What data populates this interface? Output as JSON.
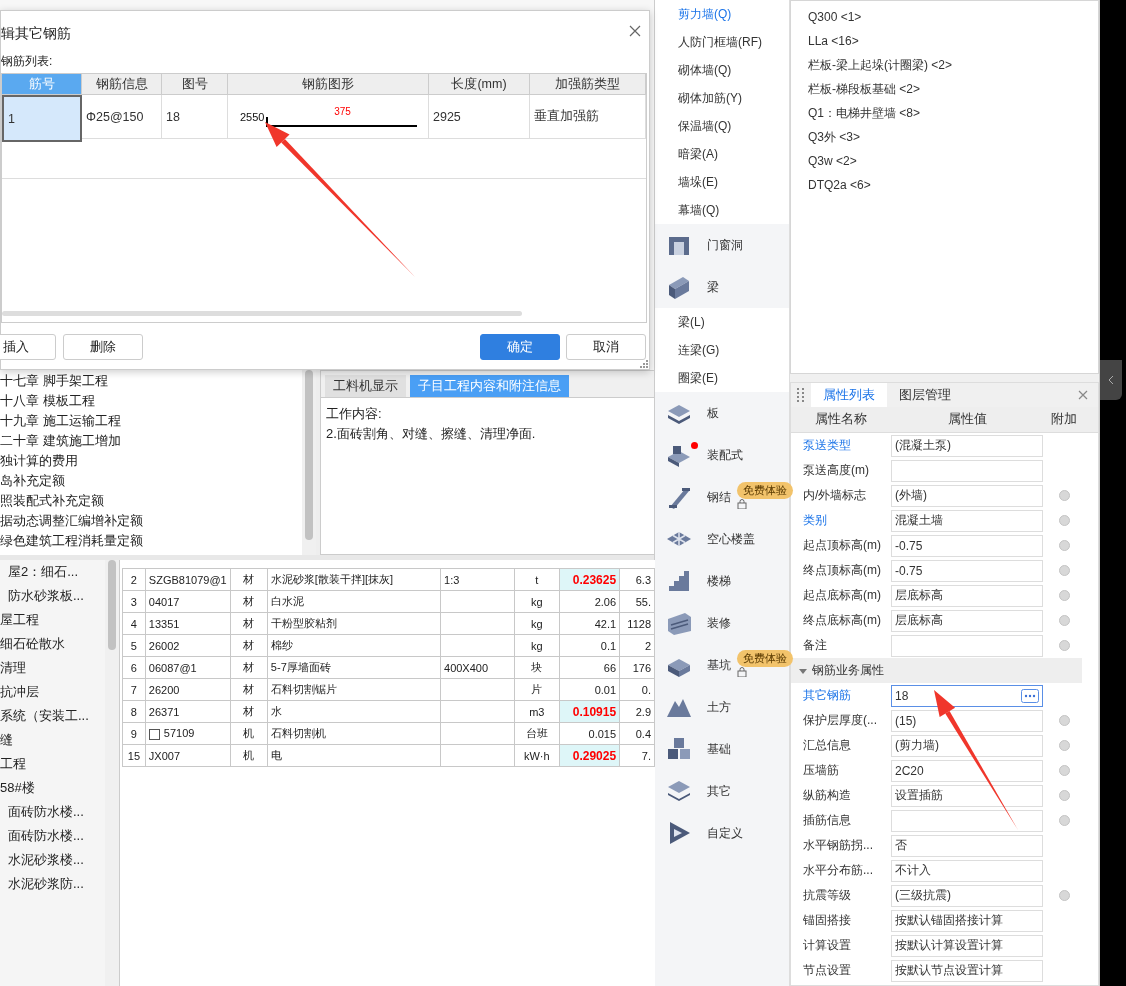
{
  "dialog": {
    "title": "辑其它钢筋",
    "list_label": "钢筋列表:",
    "columns": [
      "筋号",
      "钢筋信息",
      "图号",
      "钢筋图形",
      "长度(mm)",
      "加强筋类型"
    ],
    "rows": [
      {
        "no": "1",
        "info": "Φ25@150",
        "figure": "18",
        "shape": {
          "left_label": "2550",
          "top_label": "375"
        },
        "length": "2925",
        "type": "垂直加强筋",
        "selected": true
      }
    ],
    "buttons": [
      {
        "label": "插入",
        "kind": "plain"
      },
      {
        "label": "删除",
        "kind": "plain"
      },
      {
        "label": "确定",
        "kind": "primary"
      },
      {
        "label": "取消",
        "kind": "plain"
      }
    ]
  },
  "chapter_tree": {
    "items": [
      "十七章 脚手架工程",
      "十八章 模板工程",
      "十九章 施工运输工程",
      "二十章 建筑施工增加",
      "独计算的费用",
      "岛补充定额",
      "照装配式补充定额",
      "据动态调整汇编增补定额",
      "绿色建筑工程消耗量定额"
    ]
  },
  "detail_panel": {
    "tabs": [
      {
        "label": "工料机显示",
        "selected": false
      },
      {
        "label": "子目工程内容和附注信息",
        "selected": true
      }
    ],
    "lines": [
      "工作内容:",
      "2.面砖割角、对缝、擦缝、清理净面."
    ]
  },
  "project_tree": {
    "items": [
      {
        "label": "屋2：细石...",
        "kind": "child"
      },
      {
        "label": "防水砂浆板...",
        "kind": "child"
      },
      {
        "label": "屋工程",
        "kind": "root"
      },
      {
        "label": "细石砼散水",
        "kind": "root"
      },
      {
        "label": "清理",
        "kind": "root"
      },
      {
        "label": "抗冲层",
        "kind": "root"
      },
      {
        "label": "系统（安装工...",
        "kind": "root"
      },
      {
        "label": "缝",
        "kind": "root"
      },
      {
        "label": "工程",
        "kind": "root"
      },
      {
        "label": "58#楼",
        "kind": "root"
      },
      {
        "label": "面砖防水楼...",
        "kind": "child"
      },
      {
        "label": "面砖防水楼...",
        "kind": "child"
      },
      {
        "label": "水泥砂浆楼...",
        "kind": "child"
      },
      {
        "label": "水泥砂浆防...",
        "kind": "child"
      }
    ]
  },
  "resource_table": {
    "rows": [
      {
        "no": "2",
        "code": "SZGB81079@1",
        "type": "材",
        "name": "水泥砂浆[散装干拌][抹灰]",
        "spec": "1:3",
        "unit": "t",
        "quantity": "0.23625",
        "highlighted": true,
        "expandable": false,
        "column_8": "6.3"
      },
      {
        "no": "3",
        "code": "04017",
        "type": "材",
        "name": "白水泥",
        "unit": "kg",
        "quantity": "2.06",
        "highlighted": false,
        "expandable": false,
        "column_8": "55."
      },
      {
        "no": "4",
        "code": "13351",
        "type": "材",
        "name": "干粉型胶粘剂",
        "unit": "kg",
        "quantity": "42.1",
        "highlighted": false,
        "expandable": false,
        "column_8": "1128"
      },
      {
        "no": "5",
        "code": "26002",
        "type": "材",
        "name": "棉纱",
        "unit": "kg",
        "quantity": "0.1",
        "highlighted": false,
        "expandable": false,
        "column_8": "2"
      },
      {
        "no": "6",
        "code": "06087@1",
        "type": "材",
        "name": "5-7厚墙面砖",
        "spec": "400X400",
        "unit": "块",
        "quantity": "66",
        "highlighted": false,
        "expandable": false,
        "column_8": "176"
      },
      {
        "no": "7",
        "code": "26200",
        "type": "材",
        "name": "石料切割锯片",
        "unit": "片",
        "quantity": "0.01",
        "highlighted": false,
        "expandable": false,
        "column_8": "0."
      },
      {
        "no": "8",
        "code": "26371",
        "type": "材",
        "name": "水",
        "unit": "m3",
        "quantity": "0.10915",
        "highlighted": true,
        "expandable": false,
        "column_8": "2.9"
      },
      {
        "no": "9",
        "code": "57109",
        "type": "机",
        "name": "石料切割机",
        "unit": "台班",
        "quantity": "0.015",
        "highlighted": false,
        "expandable": true,
        "column_8": "0.4"
      },
      {
        "no": "15",
        "code": "JX007",
        "type": "机",
        "name": "电",
        "unit": "kW·h",
        "quantity": "0.29025",
        "highlighted": true,
        "expandable": false,
        "column_8": "7."
      }
    ]
  },
  "component_sidebar": {
    "items": [
      {
        "label": "剪力墙(Q)",
        "kind": "sub",
        "selected": true
      },
      {
        "label": "人防门框墙(RF)",
        "kind": "sub",
        "selected": false
      },
      {
        "label": "砌体墙(Q)",
        "kind": "sub",
        "selected": false
      },
      {
        "label": "砌体加筋(Y)",
        "kind": "sub",
        "selected": false
      },
      {
        "label": "保温墙(Q)",
        "kind": "sub",
        "selected": false
      },
      {
        "label": "暗梁(A)",
        "kind": "sub",
        "selected": false
      },
      {
        "label": "墙垛(E)",
        "kind": "sub",
        "selected": false
      },
      {
        "label": "幕墙(Q)",
        "kind": "sub",
        "selected": false
      },
      {
        "label": "门窗洞",
        "kind": "group",
        "selected": false,
        "notice": false
      },
      {
        "label": "梁",
        "kind": "group",
        "selected": false,
        "notice": false
      },
      {
        "label": "梁(L)",
        "kind": "sub",
        "selected": false
      },
      {
        "label": "连梁(G)",
        "kind": "sub",
        "selected": false
      },
      {
        "label": "圈梁(E)",
        "kind": "sub",
        "selected": false
      },
      {
        "label": "板",
        "kind": "group",
        "selected": false,
        "notice": false
      },
      {
        "label": "装配式",
        "kind": "group",
        "selected": false,
        "notice": true
      },
      {
        "label": "钢结",
        "kind": "group",
        "selected": false,
        "notice": false,
        "badge": "免费体验"
      },
      {
        "label": "空心楼盖",
        "kind": "group",
        "selected": false,
        "notice": false
      },
      {
        "label": "楼梯",
        "kind": "group",
        "selected": false,
        "notice": false
      },
      {
        "label": "装修",
        "kind": "group",
        "selected": false,
        "notice": false
      },
      {
        "label": "基坑",
        "kind": "group",
        "selected": false,
        "notice": false,
        "badge": "免费体验"
      },
      {
        "label": "土方",
        "kind": "group",
        "selected": false,
        "notice": false
      },
      {
        "label": "基础",
        "kind": "group",
        "selected": false,
        "notice": false
      },
      {
        "label": "其它",
        "kind": "group",
        "selected": false,
        "notice": false
      },
      {
        "label": "自定义",
        "kind": "group",
        "selected": false,
        "notice": false
      }
    ]
  },
  "component_list": {
    "items": [
      "Q300 <1>",
      "LLa <16>",
      "栏板-梁上起垛(计圈梁) <2>",
      "栏板-梯段板基础 <2>",
      "Q1：电梯井壁墙 <8>",
      "Q3外 <3>",
      "Q3w <2>",
      "DTQ2a <6>"
    ]
  },
  "property_panel": {
    "tabs": [
      {
        "label": "属性列表",
        "selected": true
      },
      {
        "label": "图层管理",
        "selected": false
      }
    ],
    "columns": [
      "属性名称",
      "属性值",
      "附加"
    ],
    "rows": [
      {
        "kind": "field",
        "name": "泵送类型",
        "value": "(混凝土泵)",
        "linked": true,
        "attached": false,
        "focused": false
      },
      {
        "kind": "field",
        "name": "泵送高度(m)",
        "linked": false,
        "attached": false,
        "focused": false
      },
      {
        "kind": "field",
        "name": "内/外墙标志",
        "value": "(外墙)",
        "linked": false,
        "attached": true,
        "focused": false
      },
      {
        "kind": "field",
        "name": "类别",
        "value": "混凝土墙",
        "linked": true,
        "attached": true,
        "focused": false
      },
      {
        "kind": "field",
        "name": "起点顶标高(m)",
        "value": "-0.75",
        "linked": false,
        "attached": true,
        "focused": false
      },
      {
        "kind": "field",
        "name": "终点顶标高(m)",
        "value": "-0.75",
        "linked": false,
        "attached": true,
        "focused": false
      },
      {
        "kind": "field",
        "name": "起点底标高(m)",
        "value": "层底标高",
        "linked": false,
        "attached": true,
        "focused": false
      },
      {
        "kind": "field",
        "name": "终点底标高(m)",
        "value": "层底标高",
        "linked": false,
        "attached": true,
        "focused": false
      },
      {
        "kind": "field",
        "name": "备注",
        "linked": false,
        "attached": true,
        "focused": false
      },
      {
        "kind": "group",
        "name": "钢筋业务属性",
        "expanded": true
      },
      {
        "kind": "field",
        "name": "其它钢筋",
        "value": "18",
        "linked": true,
        "attached": false,
        "focused": true
      },
      {
        "kind": "field",
        "name": "保护层厚度(...",
        "value": "(15)",
        "linked": false,
        "attached": true,
        "focused": false
      },
      {
        "kind": "field",
        "name": "汇总信息",
        "value": "(剪力墙)",
        "linked": false,
        "attached": true,
        "focused": false
      },
      {
        "kind": "field",
        "name": "压墙筋",
        "value": "2C20",
        "linked": false,
        "attached": true,
        "focused": false
      },
      {
        "kind": "field",
        "name": "纵筋构造",
        "value": "设置插筋",
        "linked": false,
        "attached": true,
        "focused": false
      },
      {
        "kind": "field",
        "name": "插筋信息",
        "linked": false,
        "attached": true,
        "focused": false
      },
      {
        "kind": "field",
        "name": "水平钢筋拐...",
        "value": "否",
        "linked": false,
        "attached": false,
        "focused": false
      },
      {
        "kind": "field",
        "name": "水平分布筋...",
        "value": "不计入",
        "linked": false,
        "attached": false,
        "focused": false
      },
      {
        "kind": "field",
        "name": "抗震等级",
        "value": "(三级抗震)",
        "linked": false,
        "attached": true,
        "focused": false
      },
      {
        "kind": "field",
        "name": "锚固搭接",
        "value": "按默认锚固搭接计算",
        "linked": false,
        "attached": false,
        "focused": false
      },
      {
        "kind": "field",
        "name": "计算设置",
        "value": "按默认计算设置计算",
        "linked": false,
        "attached": false,
        "focused": false
      },
      {
        "kind": "field",
        "name": "节点设置",
        "value": "按默认节点设置计算",
        "linked": false,
        "attached": false,
        "focused": false
      }
    ]
  }
}
